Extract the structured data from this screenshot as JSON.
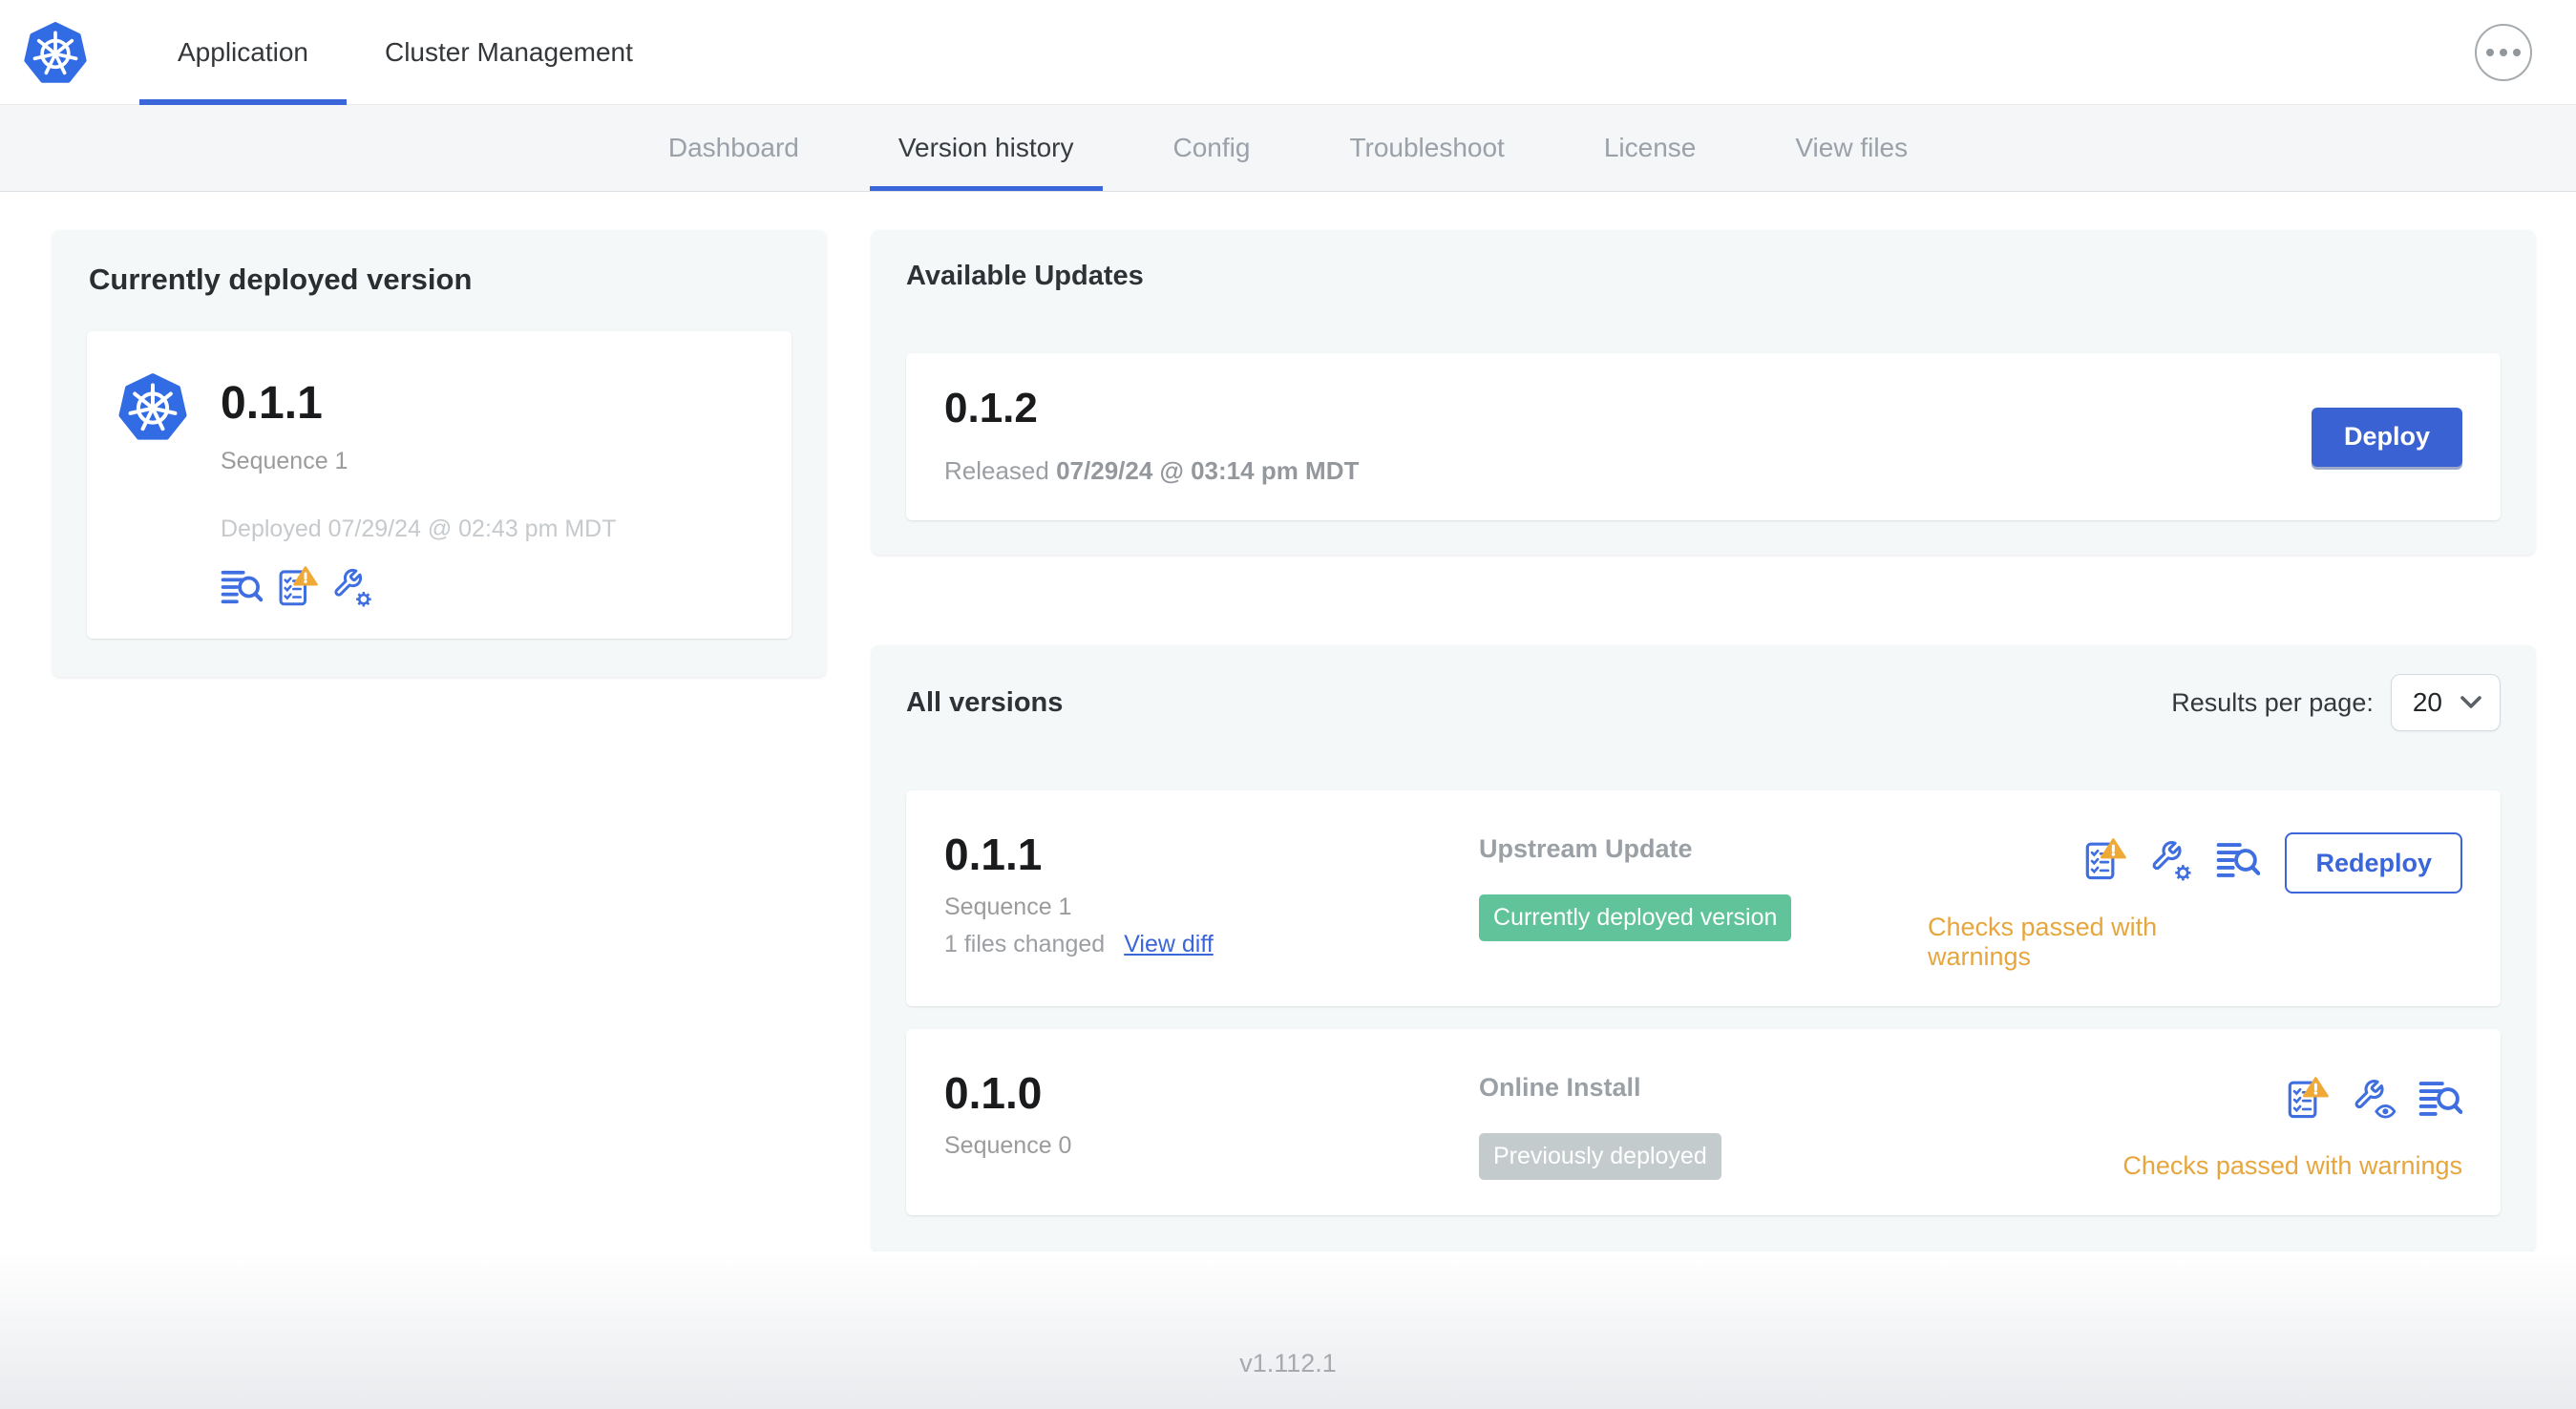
{
  "header": {
    "tabs": [
      {
        "label": "Application",
        "active": true
      },
      {
        "label": "Cluster Management",
        "active": false
      }
    ]
  },
  "subnav": {
    "tabs": [
      {
        "label": "Dashboard",
        "active": false
      },
      {
        "label": "Version history",
        "active": true
      },
      {
        "label": "Config",
        "active": false
      },
      {
        "label": "Troubleshoot",
        "active": false
      },
      {
        "label": "License",
        "active": false
      },
      {
        "label": "View files",
        "active": false
      }
    ]
  },
  "current_version_card": {
    "title": "Currently deployed version",
    "version": "0.1.1",
    "sequence": "Sequence 1",
    "deployed": "Deployed 07/29/24 @ 02:43 pm MDT",
    "icons": [
      "deploy-logs-icon",
      "preflight-checks-warning-icon",
      "edit-config-icon"
    ]
  },
  "available_updates": {
    "title": "Available Updates",
    "version": "0.1.2",
    "released_label": "Released",
    "released_date": "07/29/24 @ 03:14 pm MDT",
    "deploy_label": "Deploy"
  },
  "all_versions": {
    "title": "All versions",
    "results_per_page_label": "Results per page:",
    "results_per_page_value": "20",
    "rows": [
      {
        "version": "0.1.1",
        "sequence": "Sequence 1",
        "files_changed": "1 files changed",
        "view_diff_label": "View diff",
        "source": "Upstream Update",
        "badge_label": "Currently deployed version",
        "badge_color": "#60c39a",
        "status": "Checks passed with warnings",
        "action_label": "Redeploy",
        "icons": [
          "preflight-checks-warning-icon",
          "edit-config-icon",
          "deploy-logs-icon"
        ]
      },
      {
        "version": "0.1.0",
        "sequence": "Sequence 0",
        "source": "Online Install",
        "badge_label": "Previously deployed",
        "badge_color": "#c3cbcd",
        "status": "Checks passed with warnings",
        "icons": [
          "preflight-checks-warning-icon",
          "view-config-icon",
          "deploy-logs-icon"
        ]
      }
    ]
  },
  "footer": {
    "version": "v1.112.1"
  },
  "colors": {
    "accent_blue": "#3b66d9",
    "button_blue": "#3b62d3",
    "kubernetes_blue": "#326ce5",
    "badge_green": "#60c39a",
    "badge_gray": "#c3cbcd",
    "warning_orange": "#e7a63d",
    "panel_gray": "#f5f8f9",
    "subnav_gray": "#f4f6f8"
  }
}
